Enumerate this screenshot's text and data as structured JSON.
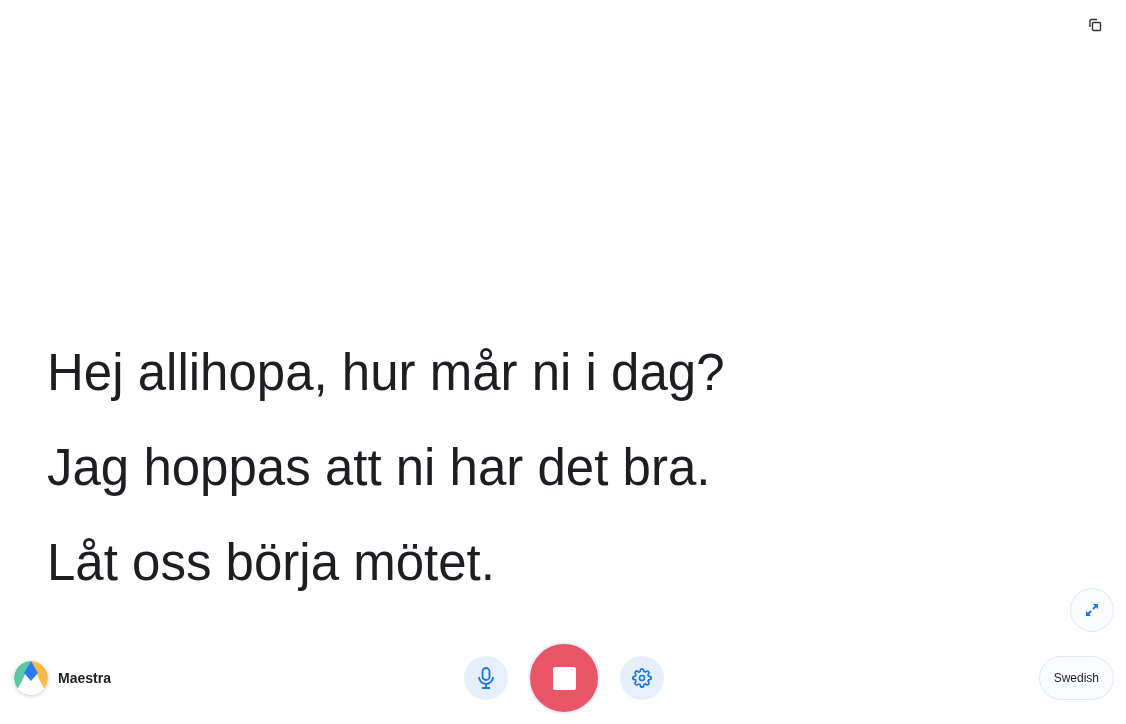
{
  "transcript": [
    "Hej allihopa, hur mår ni i dag?",
    "Jag hoppas att ni har det bra.",
    "Låt oss börja mötet."
  ],
  "brand": {
    "name": "Maestra"
  },
  "controls": {
    "recording": true
  },
  "language": {
    "label": "Swedish"
  }
}
